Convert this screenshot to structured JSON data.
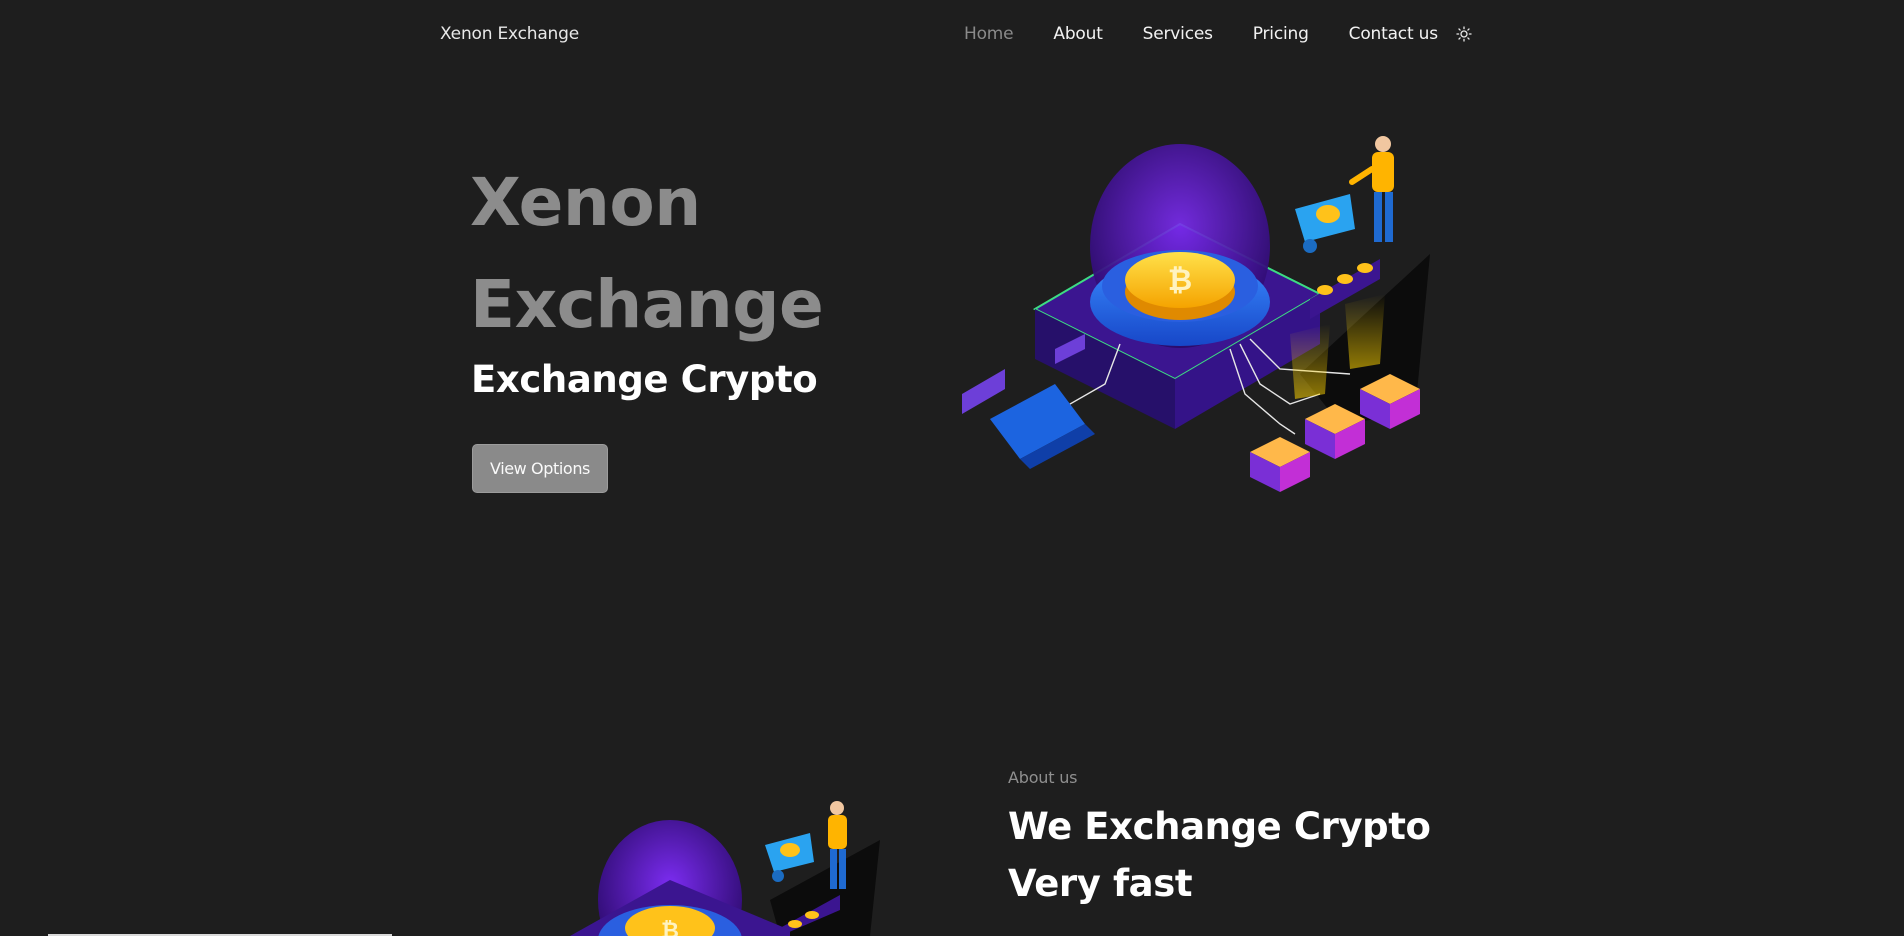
{
  "nav": {
    "brand": "Xenon Exchange",
    "items": [
      {
        "label": "Home",
        "active": true
      },
      {
        "label": "About",
        "active": false
      },
      {
        "label": "Services",
        "active": false
      },
      {
        "label": "Pricing",
        "active": false
      },
      {
        "label": "Contact us",
        "active": false
      }
    ],
    "theme_icon": "sun-icon"
  },
  "hero": {
    "title_line1": "Xenon",
    "title_line2": "Exchange",
    "subtitle": "Exchange Crypto",
    "button_label": "View Options",
    "illustration": "crypto-mining-illustration"
  },
  "about": {
    "label": "About us",
    "title_line1": "We Exchange Crypto",
    "title_line2": "Very fast",
    "illustration": "crypto-mining-illustration"
  },
  "colors": {
    "background": "#1e1e1e",
    "muted_text": "#8c8c8c",
    "button": "#8a8a8a",
    "coin_gold": "#f5c518",
    "platform_purple": "#5a1fb8",
    "accent_blue": "#1e90ff"
  }
}
